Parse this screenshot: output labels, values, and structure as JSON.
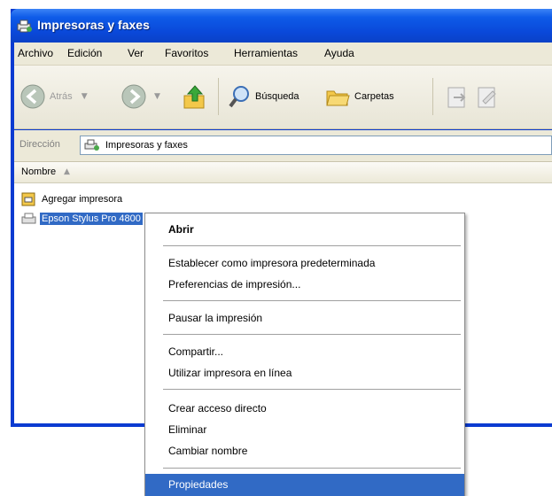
{
  "window": {
    "title": "Impresoras y faxes"
  },
  "menu": [
    "Archivo",
    "Edición",
    "Ver",
    "Favoritos",
    "Herramientas",
    "Ayuda"
  ],
  "toolbar": {
    "back": "Atrás",
    "search": "Búsqueda",
    "folders": "Carpetas"
  },
  "address": {
    "label": "Dirección",
    "value": "Impresoras y faxes"
  },
  "list": {
    "column_name": "Nombre",
    "items": [
      "Agregar impresora",
      "Epson Stylus Pro 4800"
    ]
  },
  "context_menu": {
    "open": "Abrir",
    "set_default": "Establecer como impresora predeterminada",
    "prefs": "Preferencias de impresión...",
    "pause": "Pausar la impresión",
    "share": "Compartir...",
    "online": "Utilizar impresora en línea",
    "shortcut": "Crear acceso directo",
    "delete": "Eliminar",
    "rename": "Cambiar nombre",
    "properties": "Propiedades"
  },
  "colors": {
    "title_blue": "#0a48d9",
    "selection": "#316ac5",
    "chrome": "#ece9d8"
  }
}
